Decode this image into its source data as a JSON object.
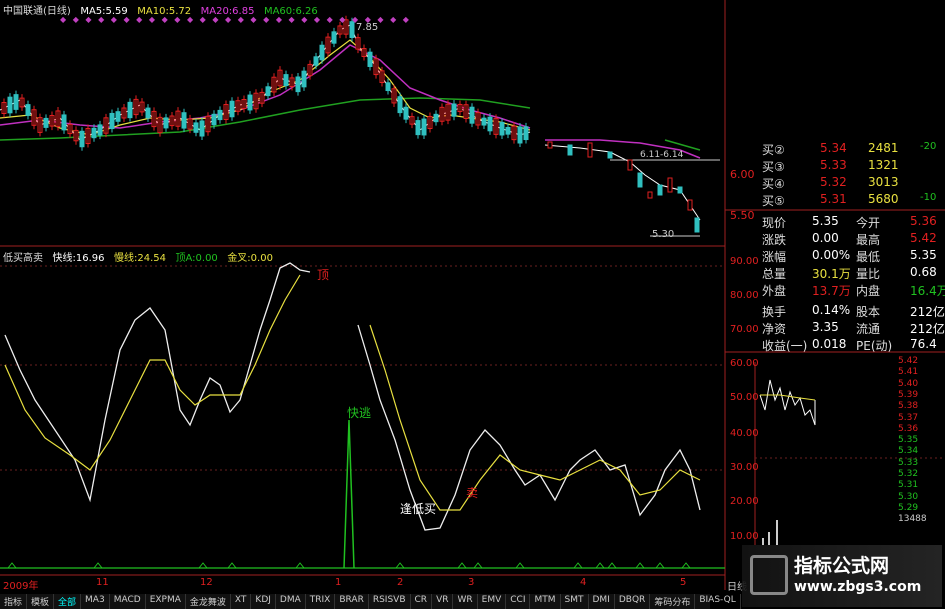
{
  "main_header": {
    "name": "中国联通(日线)",
    "ma5": "MA5:5.59",
    "ma10": "MA10:5.72",
    "ma20": "MA20:6.85",
    "ma60": "MA60:6.26"
  },
  "price_annotations": {
    "peak": "7.85",
    "range": "6.11-6.14",
    "low": "5.30"
  },
  "price_axis": [
    "6.00",
    "5.50"
  ],
  "indicator_header": {
    "name": "低买高卖",
    "fast": "快线:16.96",
    "slow": "慢线:24.54",
    "top": "顶A:0.00",
    "cross": "金叉:0.00"
  },
  "indicator_labels": {
    "top": "顶",
    "fast_escape": "快逃",
    "low_buy": "逢低买",
    "sell": "卖"
  },
  "indicator_axis": [
    "90.00",
    "80.00",
    "70.00",
    "60.00",
    "50.00",
    "40.00",
    "30.00",
    "20.00",
    "10.00"
  ],
  "date_axis": {
    "year": "2009年",
    "months": [
      "11",
      "12",
      "1",
      "2",
      "3",
      "4",
      "5"
    ],
    "right": "日线"
  },
  "quote": {
    "bids": [
      {
        "label": "买②",
        "price": "5.34",
        "vol": "2481",
        "chg": "-20"
      },
      {
        "label": "买③",
        "price": "5.33",
        "vol": "1321",
        "chg": ""
      },
      {
        "label": "买④",
        "price": "5.32",
        "vol": "3013",
        "chg": ""
      },
      {
        "label": "买⑤",
        "price": "5.31",
        "vol": "5680",
        "chg": "-10"
      }
    ],
    "rows": [
      {
        "l1": "现价",
        "v1": "5.35",
        "l2": "今开",
        "v2": "5.36"
      },
      {
        "l1": "涨跌",
        "v1": "0.00",
        "l2": "最高",
        "v2": "5.42"
      },
      {
        "l1": "涨幅",
        "v1": "0.00%",
        "l2": "最低",
        "v2": "5.35"
      },
      {
        "l1": "总量",
        "v1": "30.1万",
        "l2": "量比",
        "v2": "0.68"
      },
      {
        "l1": "外盘",
        "v1": "13.7万",
        "l2": "内盘",
        "v2": "16.4万"
      },
      {
        "l1": "换手",
        "v1": "0.14%",
        "l2": "股本",
        "v2": "212亿"
      },
      {
        "l1": "净资",
        "v1": "3.35",
        "l2": "流通",
        "v2": "212亿"
      },
      {
        "l1": "收益(一)",
        "v1": "0.018",
        "l2": "PE(动)",
        "v2": "76.4"
      }
    ]
  },
  "mini_axis": [
    "5.42",
    "5.41",
    "5.40",
    "5.39",
    "5.38",
    "5.37",
    "5.36",
    "5.35",
    "5.34",
    "5.33",
    "5.32",
    "5.31",
    "5.30",
    "5.29",
    "13488"
  ],
  "tabs": [
    "指标",
    "模板",
    "全部",
    "MA3",
    "MACD",
    "EXPMA",
    "金龙舞波",
    "XT",
    "KDJ",
    "DMA",
    "TRIX",
    "BRAR",
    "RSISVB",
    "CR",
    "VR",
    "WR",
    "EMV",
    "CCI",
    "MTM",
    "SMT",
    "DMI",
    "DBQR",
    "筹码分布",
    "BIAS-QL"
  ],
  "watermark": {
    "title": "指标公式网",
    "url": "www.zbgs3.com"
  },
  "colors": {
    "red": "#e02020",
    "white": "#eeeeee",
    "yellow": "#e8e040",
    "magenta": "#e040e0",
    "green": "#20c020",
    "cyan": "#30c0c0"
  }
}
